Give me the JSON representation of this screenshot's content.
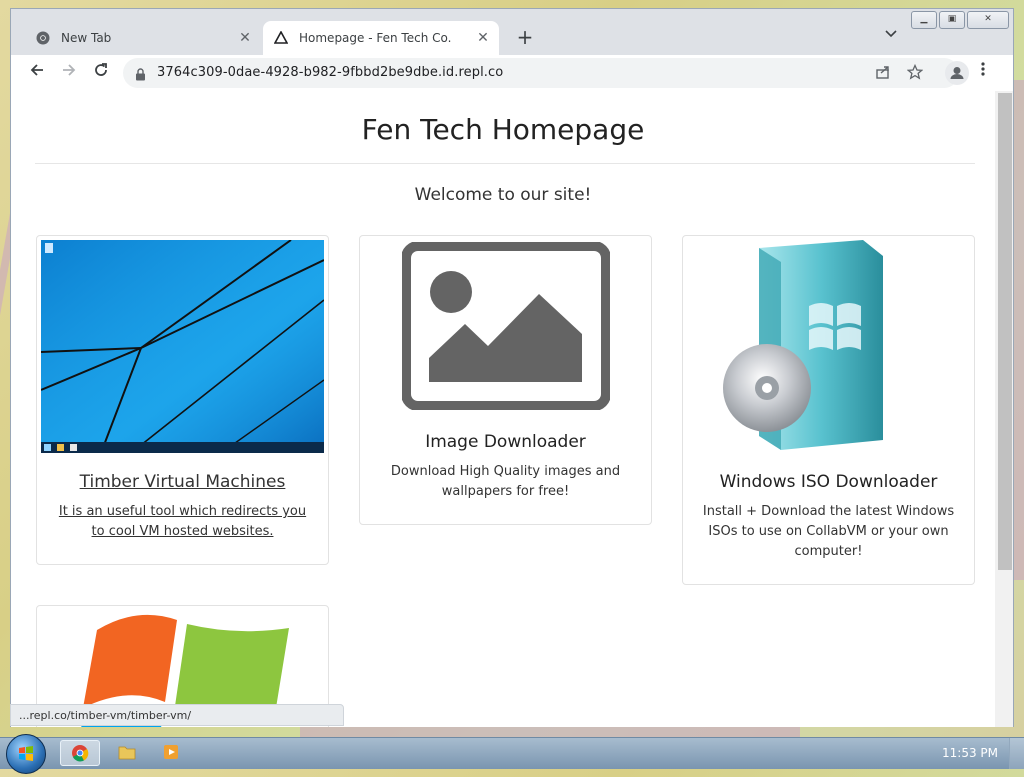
{
  "browser": {
    "tabs": [
      {
        "title": "New Tab",
        "active": false
      },
      {
        "title": "Homepage - Fen Tech Co.",
        "active": true
      }
    ],
    "url": "3764c309-0dae-4928-b982-9fbbd2be9dbe.id.repl.co",
    "status_url": "...repl.co/timber-vm/timber-vm/"
  },
  "page": {
    "title": "Fen Tech Homepage",
    "welcome": "Welcome to our site!",
    "cards": [
      {
        "title": "Timber Virtual Machines",
        "description": "It is an useful tool which redirects you to cool VM hosted websites."
      },
      {
        "title": "Image Downloader",
        "description": "Download High Quality images and wallpapers for free!"
      },
      {
        "title": "Windows ISO Downloader",
        "description": "Install + Download the latest Windows ISOs to use on CollabVM or your own computer!"
      }
    ]
  },
  "taskbar": {
    "clock": "11:53 PM"
  },
  "colors": {
    "desktop": "#dcd49a",
    "desktop_stripe": "#c9a3c7",
    "win8_blue": "#1a9fe6",
    "placeholder_gray": "#646464",
    "taskbar": "#8ea7bf"
  }
}
